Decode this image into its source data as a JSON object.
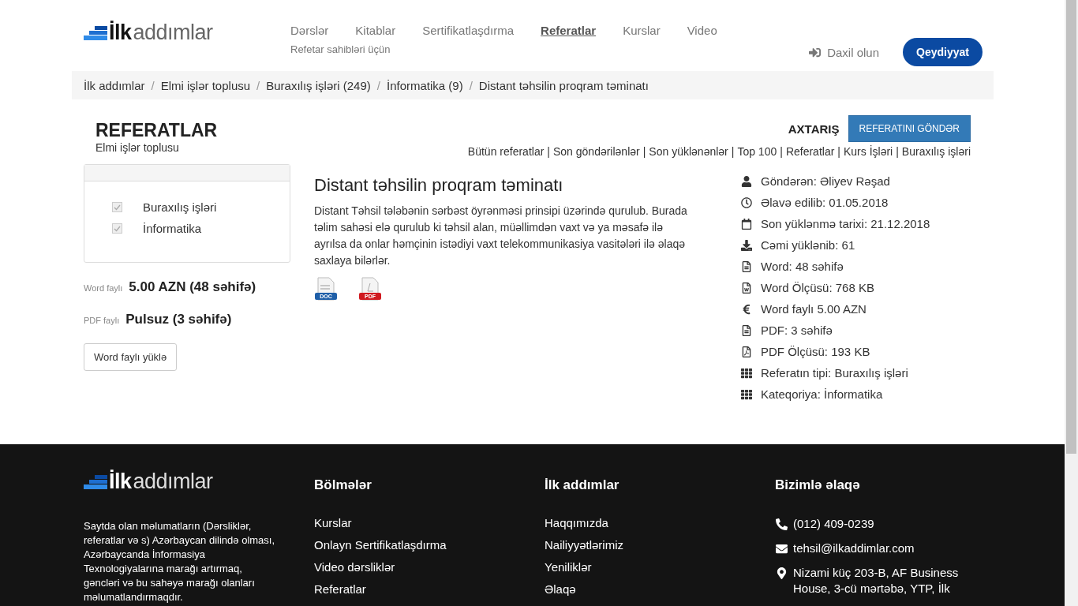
{
  "header": {
    "logo": {
      "bold": "İlk",
      "rest": "addımlar"
    },
    "nav": [
      {
        "label": "Dərslər",
        "selected": false
      },
      {
        "label": "Kitablar",
        "selected": false
      },
      {
        "label": "Sertifikatlaşdırma",
        "selected": false
      },
      {
        "label": "Referatlar",
        "selected": true
      },
      {
        "label": "Kurslar",
        "selected": false
      },
      {
        "label": "Video",
        "selected": false
      }
    ],
    "nav_sub": "Refetar sahibləri üçün",
    "login": "Daxil olun",
    "register": "Qeydiyyat"
  },
  "breadcrumb_separator": "/",
  "breadcrumb": [
    "İlk addımlar",
    "Elmi işlər toplusu",
    "Buraxılış işləri (249)",
    "İnformatika (9)",
    "Distant təhsilin proqram təminatı"
  ],
  "sidebar": {
    "title": "REFERATLAR",
    "subtitle": "Elmi işlər toplusu",
    "filters": [
      {
        "label": "Buraxılış işləri",
        "checked": true
      },
      {
        "label": "İnformatika",
        "checked": true
      }
    ],
    "prices": [
      {
        "label": "Word faylı",
        "value": "5.00 AZN (48 səhifə)"
      },
      {
        "label": "PDF faylı",
        "value": "Pulsuz (3 səhifə)"
      }
    ],
    "download_button": "Word faylı yüklə"
  },
  "toolbar": {
    "search": "AXTARIŞ",
    "submit": "REFERATINI GÖNDƏR",
    "links": [
      "Bütün referatlar",
      "Son göndərilənlər",
      "Son yüklənənlər",
      "Top 100",
      "Referatlar",
      "Kurs İşləri",
      "Buraxılış işləri"
    ],
    "separator": "|"
  },
  "article": {
    "title": "Distant təhsilin proqram təminatı",
    "description": "Distant Təhsil tələbənin sərbəst öyrənməsi prinsipi üzərində qurulub. Burada təlim sahəsi elə qurulub ki təhsil alan, müəllimdən vaxt və ya məsafə ilə ayrılsa da onlar həmçinin istədiyi vaxt telekommunikasiya vasitələri ilə əlaqə saxlaya bilərlər.",
    "files": [
      {
        "kind": "doc",
        "label": "DOC"
      },
      {
        "kind": "pdf",
        "label": "PDF"
      }
    ]
  },
  "info": [
    {
      "kind": "user",
      "text": "Göndərən: Əliyev Rəşad"
    },
    {
      "kind": "clock",
      "text": "Əlavə edilib: 01.05.2018"
    },
    {
      "kind": "calendar",
      "text": "Son yüklənmə tarixi: 21.12.2018"
    },
    {
      "kind": "download",
      "text": "Cəmi yüklənib: 61"
    },
    {
      "kind": "file",
      "text": "Word: 48 səhifə"
    },
    {
      "kind": "word",
      "text": "Word Ölçüsü: 768 KB"
    },
    {
      "kind": "euro",
      "text": "Word faylı 5.00 AZN"
    },
    {
      "kind": "file",
      "text": "PDF: 3 səhifə"
    },
    {
      "kind": "pdf",
      "text": "PDF Ölçüsü: 193 KB"
    },
    {
      "kind": "grid",
      "text": "Referatın tipi: Buraxılış işləri"
    },
    {
      "kind": "grid",
      "text": "Kateqoriya: İnformatika"
    }
  ],
  "footer": {
    "logo": {
      "bold": "İlk",
      "rest": "addımlar"
    },
    "about": "Saytda olan məlumatların (Dərsliklər, referatlar və s) Azərbaycan dilində olması, Azərbaycanda İnformasiya Texnologiyalarına marağı artırmaq, gəncləri və bu sahəyə marağı olanları məlumatlandırmaqdır.",
    "columns": [
      {
        "title": "Bölmələr",
        "links": [
          "Kurslar",
          "Onlayn Sertifikatlaşdırma",
          "Video dərsliklər",
          "Referatlar"
        ]
      },
      {
        "title": "İlk addımlar",
        "links": [
          "Haqqımızda",
          "Nailiyyətlərimiz",
          "Yeniliklər",
          "Əlaqə"
        ]
      }
    ],
    "contact": {
      "title": "Bizimlə əlaqə",
      "items": [
        {
          "kind": "phone",
          "text": "(012) 409-0239"
        },
        {
          "kind": "email",
          "text": "tehsil@ilkaddimlar.com"
        },
        {
          "kind": "address",
          "text": "Nizami küç 203-B, AF Business House, 3-cü mərtəbə, YTP, İlk"
        }
      ]
    }
  }
}
